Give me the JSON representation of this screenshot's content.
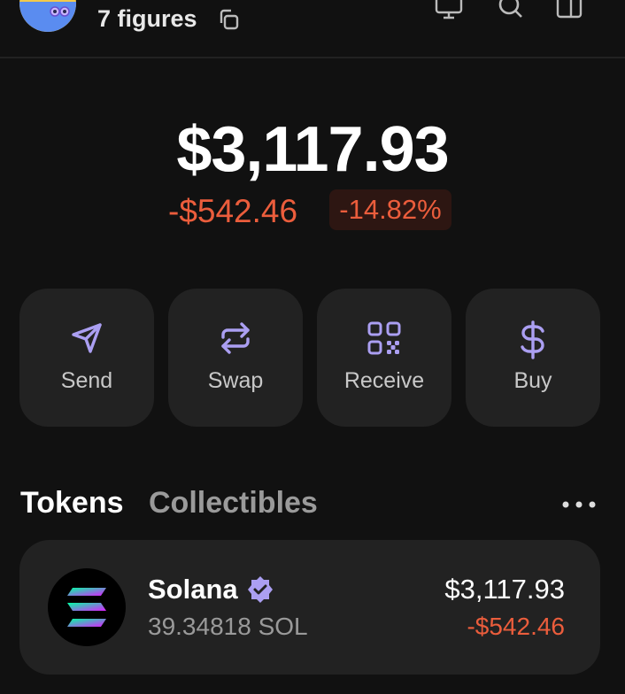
{
  "header": {
    "account_name": "7 figures",
    "icons": [
      "avatar",
      "copy-icon",
      "monitor-icon",
      "search-icon",
      "sidebar-icon"
    ]
  },
  "portfolio": {
    "balance": "$3,117.93",
    "change_value": "-$542.46",
    "change_percent": "-14.82%"
  },
  "actions": [
    {
      "label": "Send",
      "icon": "send-icon"
    },
    {
      "label": "Swap",
      "icon": "swap-icon"
    },
    {
      "label": "Receive",
      "icon": "qr-code-icon"
    },
    {
      "label": "Buy",
      "icon": "dollar-icon"
    }
  ],
  "tabs": {
    "tokens": "Tokens",
    "collectibles": "Collectibles",
    "active": "Tokens"
  },
  "tokens": [
    {
      "name": "Solana",
      "verified": true,
      "amount": "39.34818 SOL",
      "value": "$3,117.93",
      "change": "-$542.46"
    }
  ],
  "colors": {
    "background": "#111111",
    "card": "#222222",
    "accent": "#ab9ff2",
    "negative": "#eb5d3c"
  }
}
